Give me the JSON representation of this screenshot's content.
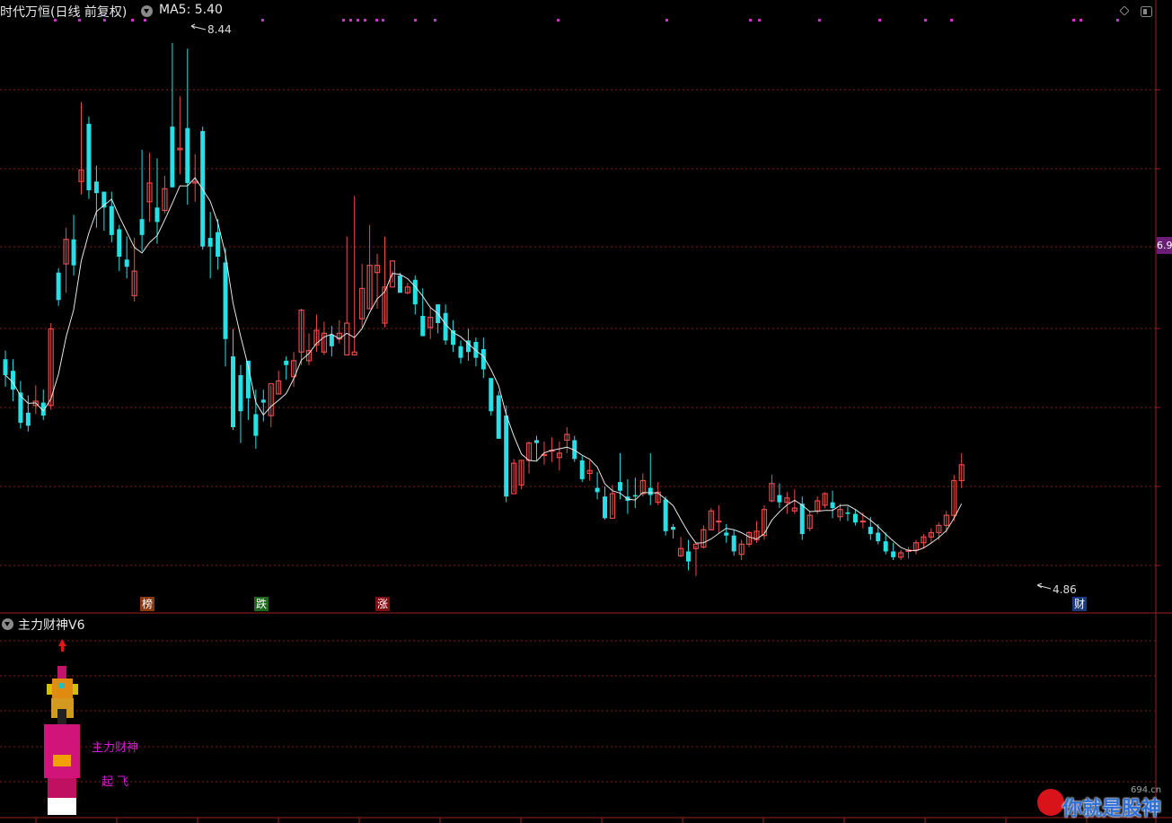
{
  "header": {
    "stock_title": "时代万恒(日线 前复权)",
    "ma5_label": "MA5: 5.40",
    "high_annotation": "8.44",
    "low_annotation": "4.86",
    "price_tag": "6.9"
  },
  "markers": {
    "bang": "榜",
    "die": "跌",
    "zhang": "涨",
    "cai": "财"
  },
  "sub_panel": {
    "title": "主力财神V6",
    "label_main": "主力财神",
    "label_takeoff": "起 飞"
  },
  "watermark": {
    "text": "你就是股神",
    "site": "694.cn"
  },
  "colors": {
    "up": "#e84b4b",
    "down": "#27e0e6",
    "ma": "#e6e6e6",
    "grid": "#8a1c1c",
    "signal_dot": "#cc33cc"
  },
  "chart_data": {
    "type": "candlestick",
    "ylim": [
      4.5,
      8.6
    ],
    "candles": [
      {
        "o": 6.25,
        "h": 6.31,
        "l": 6.06,
        "c": 6.14
      },
      {
        "o": 6.17,
        "h": 6.25,
        "l": 5.96,
        "c": 6.04
      },
      {
        "o": 6.02,
        "h": 6.1,
        "l": 5.77,
        "c": 5.81
      },
      {
        "o": 5.88,
        "h": 6.0,
        "l": 5.75,
        "c": 5.79
      },
      {
        "o": 5.93,
        "h": 6.07,
        "l": 5.87,
        "c": 5.96
      },
      {
        "o": 5.95,
        "h": 6.04,
        "l": 5.83,
        "c": 5.86
      },
      {
        "o": 5.93,
        "h": 6.5,
        "l": 5.9,
        "c": 6.46
      },
      {
        "o": 6.85,
        "h": 6.88,
        "l": 6.62,
        "c": 6.66
      },
      {
        "o": 6.91,
        "h": 7.16,
        "l": 6.71,
        "c": 7.08
      },
      {
        "o": 7.08,
        "h": 7.25,
        "l": 6.83,
        "c": 6.9
      },
      {
        "o": 7.48,
        "h": 8.03,
        "l": 7.39,
        "c": 7.56
      },
      {
        "o": 7.88,
        "h": 7.93,
        "l": 7.36,
        "c": 7.42
      },
      {
        "o": 7.48,
        "h": 7.59,
        "l": 7.16,
        "c": 7.4
      },
      {
        "o": 7.41,
        "h": 7.41,
        "l": 7.14,
        "c": 7.3
      },
      {
        "o": 7.31,
        "h": 7.41,
        "l": 7.06,
        "c": 7.11
      },
      {
        "o": 7.15,
        "h": 7.18,
        "l": 6.86,
        "c": 6.96
      },
      {
        "o": 6.94,
        "h": 7.1,
        "l": 6.81,
        "c": 6.89
      },
      {
        "o": 6.69,
        "h": 7.09,
        "l": 6.65,
        "c": 6.86
      },
      {
        "o": 7.22,
        "h": 7.7,
        "l": 7.0,
        "c": 7.11
      },
      {
        "o": 7.34,
        "h": 7.68,
        "l": 7.2,
        "c": 7.47
      },
      {
        "o": 7.3,
        "h": 7.64,
        "l": 7.05,
        "c": 7.2
      },
      {
        "o": 7.28,
        "h": 7.52,
        "l": 7.26,
        "c": 7.43
      },
      {
        "o": 7.86,
        "h": 8.44,
        "l": 7.61,
        "c": 7.44
      },
      {
        "o": 7.7,
        "h": 8.07,
        "l": 7.53,
        "c": 7.71
      },
      {
        "o": 7.85,
        "h": 8.4,
        "l": 7.32,
        "c": 7.47
      },
      {
        "o": 7.47,
        "h": 7.67,
        "l": 7.34,
        "c": 7.48
      },
      {
        "o": 7.83,
        "h": 7.86,
        "l": 7.01,
        "c": 7.03
      },
      {
        "o": 7.09,
        "h": 7.27,
        "l": 6.81,
        "c": 7.03
      },
      {
        "o": 7.13,
        "h": 7.22,
        "l": 6.87,
        "c": 6.96
      },
      {
        "o": 6.92,
        "h": 7.02,
        "l": 6.2,
        "c": 6.39
      },
      {
        "o": 6.27,
        "h": 6.46,
        "l": 5.76,
        "c": 5.78
      },
      {
        "o": 6.14,
        "h": 6.21,
        "l": 5.67,
        "c": 5.89
      },
      {
        "o": 6.24,
        "h": 6.24,
        "l": 5.83,
        "c": 5.98
      },
      {
        "o": 5.87,
        "h": 6.04,
        "l": 5.63,
        "c": 5.72
      },
      {
        "o": 5.97,
        "h": 6.04,
        "l": 5.82,
        "c": 5.95
      },
      {
        "o": 5.86,
        "h": 6.07,
        "l": 5.78,
        "c": 6.08
      },
      {
        "o": 6.01,
        "h": 6.17,
        "l": 6.01,
        "c": 6.1
      },
      {
        "o": 6.24,
        "h": 6.27,
        "l": 6.11,
        "c": 6.21
      },
      {
        "o": 6.13,
        "h": 6.3,
        "l": 6.06,
        "c": 6.24
      },
      {
        "o": 6.3,
        "h": 6.6,
        "l": 6.21,
        "c": 6.59
      },
      {
        "o": 6.24,
        "h": 6.43,
        "l": 6.21,
        "c": 6.31
      },
      {
        "o": 6.35,
        "h": 6.56,
        "l": 6.3,
        "c": 6.45
      },
      {
        "o": 6.3,
        "h": 6.51,
        "l": 6.28,
        "c": 6.43
      },
      {
        "o": 6.42,
        "h": 6.48,
        "l": 6.27,
        "c": 6.34
      },
      {
        "o": 6.39,
        "h": 6.52,
        "l": 6.36,
        "c": 6.43
      },
      {
        "o": 6.28,
        "h": 7.1,
        "l": 6.5,
        "c": 6.5
      },
      {
        "o": 6.28,
        "h": 7.38,
        "l": 6.3,
        "c": 6.3
      },
      {
        "o": 6.53,
        "h": 6.91,
        "l": 6.47,
        "c": 6.74
      },
      {
        "o": 6.6,
        "h": 7.18,
        "l": 6.6,
        "c": 6.9
      },
      {
        "o": 6.85,
        "h": 6.98,
        "l": 6.6,
        "c": 6.9
      },
      {
        "o": 6.5,
        "h": 7.1,
        "l": 6.47,
        "c": 6.75
      },
      {
        "o": 6.75,
        "h": 6.86,
        "l": 6.78,
        "c": 6.93
      },
      {
        "o": 6.83,
        "h": 6.85,
        "l": 6.72,
        "c": 6.71
      },
      {
        "o": 6.71,
        "h": 6.78,
        "l": 6.7,
        "c": 6.75
      },
      {
        "o": 6.8,
        "h": 6.83,
        "l": 6.56,
        "c": 6.63
      },
      {
        "o": 6.55,
        "h": 6.74,
        "l": 6.44,
        "c": 6.41
      },
      {
        "o": 6.47,
        "h": 6.61,
        "l": 6.39,
        "c": 6.54
      },
      {
        "o": 6.63,
        "h": 6.6,
        "l": 6.43,
        "c": 6.5
      },
      {
        "o": 6.57,
        "h": 6.63,
        "l": 6.35,
        "c": 6.38
      },
      {
        "o": 6.45,
        "h": 6.52,
        "l": 6.3,
        "c": 6.35
      },
      {
        "o": 6.34,
        "h": 6.38,
        "l": 6.22,
        "c": 6.26
      },
      {
        "o": 6.38,
        "h": 6.46,
        "l": 6.24,
        "c": 6.3
      },
      {
        "o": 6.37,
        "h": 6.4,
        "l": 6.2,
        "c": 6.26
      },
      {
        "o": 6.32,
        "h": 6.4,
        "l": 6.12,
        "c": 6.18
      },
      {
        "o": 6.12,
        "h": 6.12,
        "l": 5.86,
        "c": 5.89
      },
      {
        "o": 6.0,
        "h": 6.03,
        "l": 5.7,
        "c": 5.7
      },
      {
        "o": 5.86,
        "h": 5.93,
        "l": 5.26,
        "c": 5.3
      },
      {
        "o": 5.32,
        "h": 5.56,
        "l": 5.33,
        "c": 5.53
      },
      {
        "o": 5.38,
        "h": 5.55,
        "l": 5.35,
        "c": 5.55
      },
      {
        "o": 5.55,
        "h": 5.68,
        "l": 5.46,
        "c": 5.67
      },
      {
        "o": 5.69,
        "h": 5.72,
        "l": 5.55,
        "c": 5.67
      },
      {
        "o": 5.59,
        "h": 5.68,
        "l": 5.52,
        "c": 5.59
      },
      {
        "o": 5.62,
        "h": 5.71,
        "l": 5.54,
        "c": 5.62
      },
      {
        "o": 5.57,
        "h": 5.68,
        "l": 5.48,
        "c": 5.6
      },
      {
        "o": 5.69,
        "h": 5.78,
        "l": 5.6,
        "c": 5.73
      },
      {
        "o": 5.69,
        "h": 5.72,
        "l": 5.54,
        "c": 5.56
      },
      {
        "o": 5.55,
        "h": 5.58,
        "l": 5.4,
        "c": 5.42
      },
      {
        "o": 5.46,
        "h": 5.55,
        "l": 5.41,
        "c": 5.48
      },
      {
        "o": 5.36,
        "h": 5.47,
        "l": 5.28,
        "c": 5.33
      },
      {
        "o": 5.3,
        "h": 5.37,
        "l": 5.14,
        "c": 5.15
      },
      {
        "o": 5.15,
        "h": 5.38,
        "l": 5.17,
        "c": 5.32
      },
      {
        "o": 5.4,
        "h": 5.6,
        "l": 5.28,
        "c": 5.34
      },
      {
        "o": 5.3,
        "h": 5.42,
        "l": 5.18,
        "c": 5.27
      },
      {
        "o": 5.31,
        "h": 5.43,
        "l": 5.22,
        "c": 5.3
      },
      {
        "o": 5.32,
        "h": 5.46,
        "l": 5.3,
        "c": 5.41
      },
      {
        "o": 5.36,
        "h": 5.6,
        "l": 5.24,
        "c": 5.31
      },
      {
        "o": 5.26,
        "h": 5.4,
        "l": 5.24,
        "c": 5.33
      },
      {
        "o": 5.28,
        "h": 5.3,
        "l": 5.03,
        "c": 5.06
      },
      {
        "o": 5.09,
        "h": 5.11,
        "l": 5.01,
        "c": 5.07
      },
      {
        "o": 4.89,
        "h": 5.02,
        "l": 4.88,
        "c": 4.94
      },
      {
        "o": 4.92,
        "h": 5.0,
        "l": 4.79,
        "c": 4.85
      },
      {
        "o": 4.94,
        "h": 4.96,
        "l": 4.75,
        "c": 4.97
      },
      {
        "o": 4.95,
        "h": 5.1,
        "l": 4.94,
        "c": 5.07
      },
      {
        "o": 5.07,
        "h": 5.22,
        "l": 5.07,
        "c": 5.2
      },
      {
        "o": 5.13,
        "h": 5.24,
        "l": 5.05,
        "c": 5.13
      },
      {
        "o": 5.05,
        "h": 5.11,
        "l": 4.98,
        "c": 5.03
      },
      {
        "o": 5.03,
        "h": 5.07,
        "l": 4.89,
        "c": 4.92
      },
      {
        "o": 4.9,
        "h": 5.0,
        "l": 4.86,
        "c": 4.97
      },
      {
        "o": 4.97,
        "h": 5.06,
        "l": 4.95,
        "c": 5.05
      },
      {
        "o": 5.0,
        "h": 5.13,
        "l": 4.98,
        "c": 5.06
      },
      {
        "o": 5.03,
        "h": 5.24,
        "l": 5.0,
        "c": 5.21
      },
      {
        "o": 5.27,
        "h": 5.45,
        "l": 5.26,
        "c": 5.39
      },
      {
        "o": 5.31,
        "h": 5.39,
        "l": 5.22,
        "c": 5.26
      },
      {
        "o": 5.26,
        "h": 5.33,
        "l": 5.18,
        "c": 5.29
      },
      {
        "o": 5.2,
        "h": 5.35,
        "l": 5.18,
        "c": 5.22
      },
      {
        "o": 5.25,
        "h": 5.3,
        "l": 5.0,
        "c": 5.04
      },
      {
        "o": 5.08,
        "h": 5.2,
        "l": 5.06,
        "c": 5.17
      },
      {
        "o": 5.2,
        "h": 5.3,
        "l": 5.18,
        "c": 5.27
      },
      {
        "o": 5.24,
        "h": 5.33,
        "l": 5.22,
        "c": 5.32
      },
      {
        "o": 5.26,
        "h": 5.34,
        "l": 5.15,
        "c": 5.22
      },
      {
        "o": 5.16,
        "h": 5.25,
        "l": 5.13,
        "c": 5.21
      },
      {
        "o": 5.19,
        "h": 5.23,
        "l": 5.13,
        "c": 5.18
      },
      {
        "o": 5.18,
        "h": 5.21,
        "l": 5.1,
        "c": 5.12
      },
      {
        "o": 5.13,
        "h": 5.19,
        "l": 5.08,
        "c": 5.13
      },
      {
        "o": 5.09,
        "h": 5.16,
        "l": 5.0,
        "c": 5.04
      },
      {
        "o": 5.05,
        "h": 5.11,
        "l": 4.97,
        "c": 4.99
      },
      {
        "o": 4.99,
        "h": 5.05,
        "l": 4.9,
        "c": 4.92
      },
      {
        "o": 4.92,
        "h": 4.98,
        "l": 4.86,
        "c": 4.88
      },
      {
        "o": 4.88,
        "h": 4.93,
        "l": 4.86,
        "c": 4.91
      },
      {
        "o": 4.92,
        "h": 4.95,
        "l": 4.87,
        "c": 4.93
      },
      {
        "o": 4.93,
        "h": 5.0,
        "l": 4.9,
        "c": 4.98
      },
      {
        "o": 4.98,
        "h": 5.04,
        "l": 4.94,
        "c": 5.02
      },
      {
        "o": 5.02,
        "h": 5.08,
        "l": 4.98,
        "c": 5.05
      },
      {
        "o": 5.05,
        "h": 5.12,
        "l": 5.0,
        "c": 5.1
      },
      {
        "o": 5.1,
        "h": 5.2,
        "l": 5.05,
        "c": 5.17
      },
      {
        "o": 5.17,
        "h": 5.45,
        "l": 5.13,
        "c": 5.41
      },
      {
        "o": 5.41,
        "h": 5.6,
        "l": 5.36,
        "c": 5.52
      }
    ],
    "ma5": "computed"
  }
}
